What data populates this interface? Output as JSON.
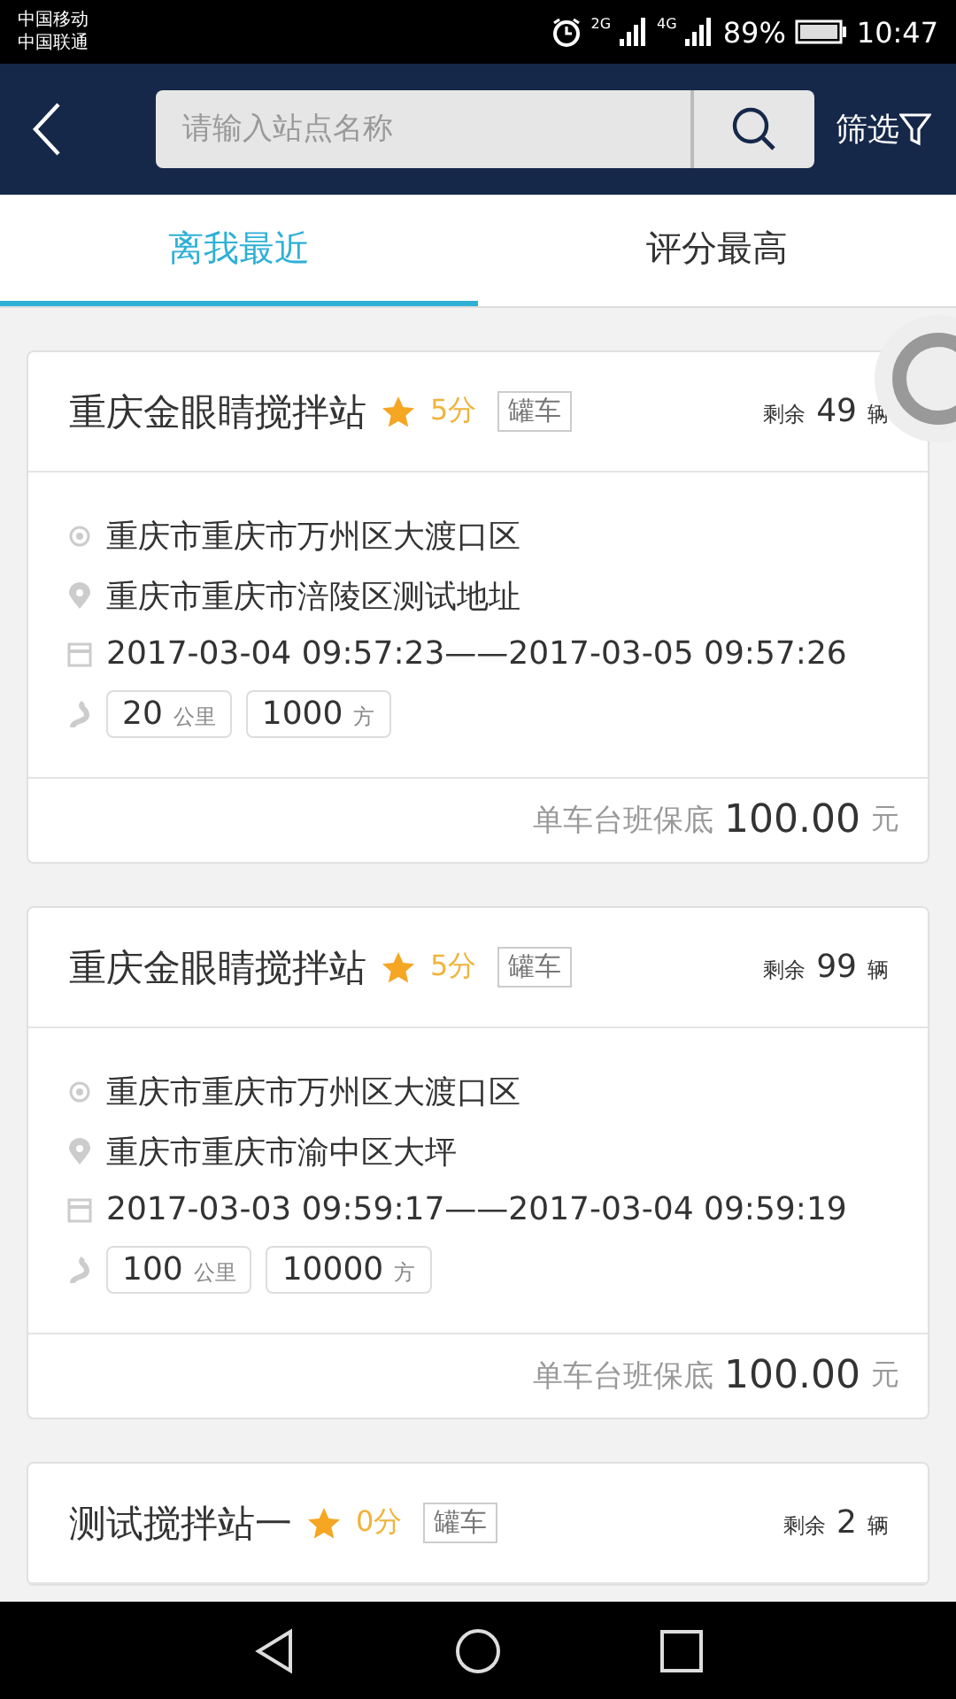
{
  "status_bar": {
    "carriers": [
      "中国移动",
      "中国联通"
    ],
    "network_1": "2G",
    "network_2": "4G",
    "battery": "89%",
    "time": "10:47"
  },
  "header": {
    "search": {
      "placeholder": "请输入站点名称"
    },
    "filter": "筛选"
  },
  "tabs": [
    {
      "label": "离我最近",
      "selected": true
    },
    {
      "label": "评分最高",
      "selected": false
    }
  ],
  "stations": [
    {
      "name": "重庆金眼睛搅拌站",
      "score": "5分",
      "tag": "罐车",
      "remaining_label": "剩余",
      "remaining": "49",
      "remaining_unit": "辆",
      "from": "重庆市重庆市万州区大渡口区",
      "to": "重庆市重庆市涪陵区测试地址",
      "time": "2017-03-04 09:57:23——2017-03-05 09:57:26",
      "distance": "20",
      "distance_unit": "公里",
      "volume": "1000",
      "volume_unit": "方",
      "price_label": "单车台班保底",
      "price": "100.00",
      "price_unit": "元"
    },
    {
      "name": "重庆金眼睛搅拌站",
      "score": "5分",
      "tag": "罐车",
      "remaining_label": "剩余",
      "remaining": "99",
      "remaining_unit": "辆",
      "from": "重庆市重庆市万州区大渡口区",
      "to": "重庆市重庆市渝中区大坪",
      "time": "2017-03-03 09:59:17——2017-03-04 09:59:19",
      "distance": "100",
      "distance_unit": "公里",
      "volume": "10000",
      "volume_unit": "方",
      "price_label": "单车台班保底",
      "price": "100.00",
      "price_unit": "元"
    },
    {
      "name": "测试搅拌站一",
      "score": "0分",
      "tag": "罐车",
      "remaining_label": "剩余",
      "remaining": "2",
      "remaining_unit": "辆"
    }
  ]
}
